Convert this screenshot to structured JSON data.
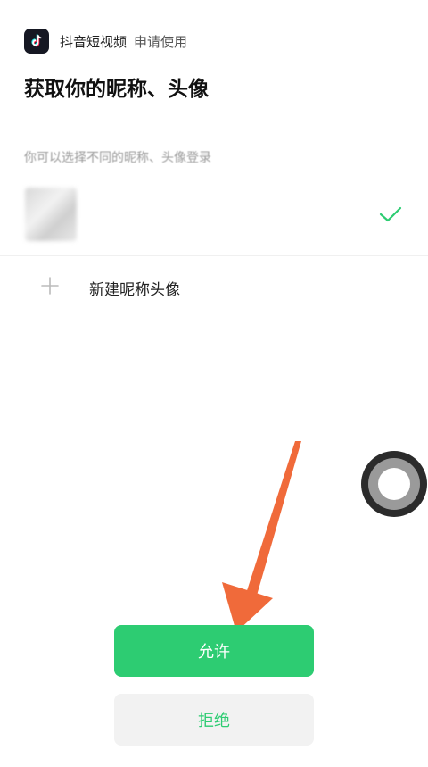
{
  "header": {
    "app_name": "抖音短视频",
    "request_label": "申请使用",
    "icon": "tiktok-logo-icon"
  },
  "title": "获取你的昵称、头像",
  "hint": "你可以选择不同的昵称、头像登录",
  "accounts": [
    {
      "name": " ",
      "subtitle": " ",
      "selected": true
    }
  ],
  "new_profile_label": "新建昵称头像",
  "buttons": {
    "allow": "允许",
    "deny": "拒绝"
  },
  "colors": {
    "accent": "#2dcc72",
    "annotation_arrow": "#f06a3a"
  }
}
